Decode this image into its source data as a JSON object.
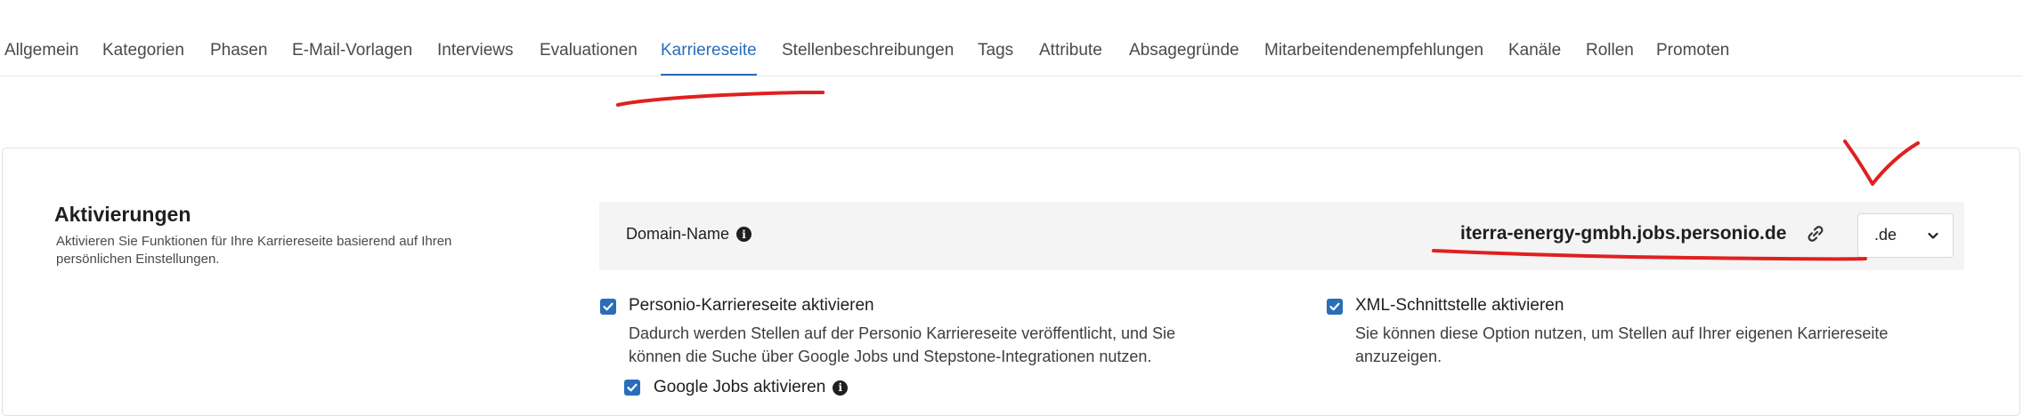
{
  "tabs": [
    {
      "label": "Allgemein",
      "active": false
    },
    {
      "label": "Kategorien",
      "active": false
    },
    {
      "label": "Phasen",
      "active": false
    },
    {
      "label": "E-Mail-Vorlagen",
      "active": false
    },
    {
      "label": "Interviews",
      "active": false
    },
    {
      "label": "Evaluationen",
      "active": false
    },
    {
      "label": "Karriereseite",
      "active": true
    },
    {
      "label": "Stellenbeschreibungen",
      "active": false
    },
    {
      "label": "Tags",
      "active": false
    },
    {
      "label": "Attribute",
      "active": false
    },
    {
      "label": "Absagegründe",
      "active": false
    },
    {
      "label": "Mitarbeitendenempfehlungen",
      "active": false
    },
    {
      "label": "Kanäle",
      "active": false
    },
    {
      "label": "Rollen",
      "active": false
    },
    {
      "label": "Promoten",
      "active": false
    }
  ],
  "section": {
    "title": "Aktivierungen",
    "description": "Aktivieren Sie Funktionen für Ihre Karriereseite basierend auf Ihren persönlichen Einstellungen."
  },
  "domain": {
    "label": "Domain-Name",
    "value": "iterra-energy-gmbh.jobs.personio.de",
    "tld_selected": ".de"
  },
  "options": {
    "career_page": {
      "label": "Personio-Karriereseite aktivieren",
      "checked": true,
      "description": "Dadurch werden Stellen auf der Personio Karriereseite veröffentlicht, und Sie können die Suche über Google Jobs und Stepstone-Integrationen nutzen."
    },
    "google_jobs": {
      "label": "Google Jobs aktivieren",
      "checked": true
    },
    "xml": {
      "label": "XML-Schnittstelle aktivieren",
      "checked": true,
      "description": "Sie können diese Option nutzen, um Stellen auf Ihrer eigenen Karriereseite anzuzeigen."
    }
  },
  "colors": {
    "accent": "#2a6db8",
    "annotation": "#e02020"
  }
}
